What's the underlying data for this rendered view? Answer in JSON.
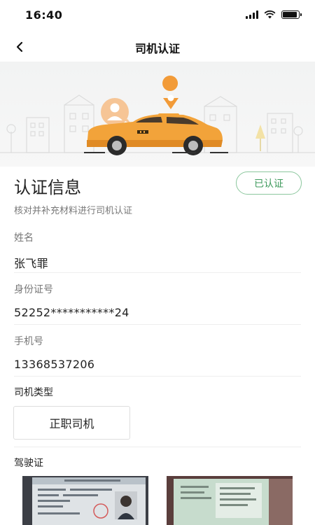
{
  "status_bar": {
    "time": "16:40",
    "battery_level": 0.9
  },
  "nav": {
    "title": "司机认证"
  },
  "header": {
    "title": "认证信息",
    "subtitle": "核对并补充材料进行司机认证",
    "status_badge": "已认证"
  },
  "fields": [
    {
      "label": "姓名",
      "value": "张飞罪"
    },
    {
      "label": "身份证号",
      "value": "52252***********24"
    },
    {
      "label": "手机号",
      "value": "13368537206"
    }
  ],
  "driver_type": {
    "label": "司机类型",
    "value": "正职司机"
  },
  "license": {
    "label": "驾驶证"
  },
  "colors": {
    "accent": "#3f9a5d",
    "car_orange": "#f2a33a",
    "pin_orange": "#f29b38"
  }
}
